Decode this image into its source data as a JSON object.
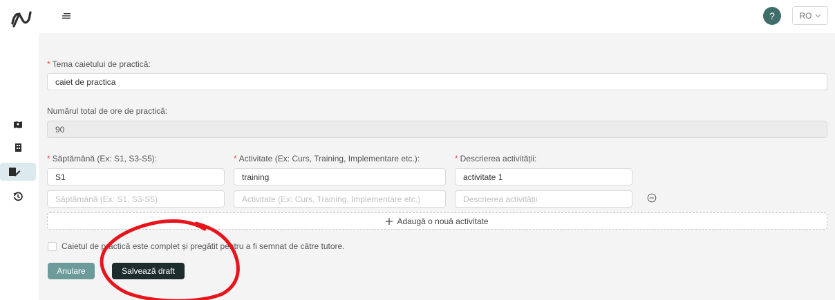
{
  "topbar": {
    "help_label": "?",
    "lang_label": "RO"
  },
  "form": {
    "topic_label": "Tema caietului de practică:",
    "topic_value": "caiet de practica",
    "hours_label": "Numărul total de ore de practică:",
    "hours_value": "90",
    "week_label": "Săptămână (Ex: S1, S3-S5):",
    "activity_label": "Activitate (Ex: Curs, Training, Implementare etc.):",
    "description_label": "Descrierea activității:",
    "rows": [
      {
        "week": "S1",
        "activity": "training",
        "description": "activitate 1"
      }
    ],
    "placeholders": {
      "week": "Săptămână (Ex: S1, S3-S5)",
      "activity": "Activitate (Ex: Curs, Training, Implementare etc.)",
      "description": "Descrierea activității"
    },
    "add_activity_label": "Adaugă o nouă activitate",
    "complete_checkbox_label": "Caietul de practică este complet și pregătit pentru a fi semnat de către tutore.",
    "cancel_label": "Anulare",
    "save_draft_label": "Salvează draft"
  },
  "colors": {
    "primary_dark": "#1d2d2c",
    "cancel_teal": "#6d9a9a",
    "required_star": "#e04848",
    "annotation_red": "#e8141c"
  },
  "icons": [
    "app-logo-icon",
    "menu-icon",
    "help-icon",
    "chevron-down-icon",
    "map-icon",
    "building-icon",
    "notebook-edit-icon",
    "history-icon",
    "minus-circle-icon",
    "plus-icon"
  ]
}
